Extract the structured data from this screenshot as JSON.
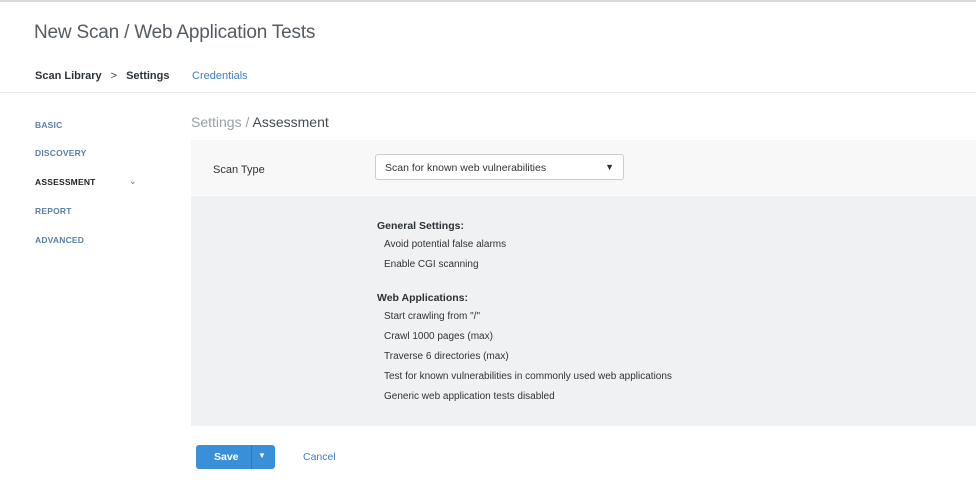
{
  "header": {
    "title": "New Scan / Web Application Tests"
  },
  "nav": {
    "breadcrumb": [
      "Scan Library",
      "Settings"
    ],
    "separator": ">",
    "credentials_link": "Credentials"
  },
  "sidebar": {
    "items": [
      {
        "label": "BASIC",
        "active": false
      },
      {
        "label": "DISCOVERY",
        "active": false
      },
      {
        "label": "ASSESSMENT",
        "active": true,
        "icon": "chevron-down-icon"
      },
      {
        "label": "REPORT",
        "active": false
      },
      {
        "label": "ADVANCED",
        "active": false
      }
    ]
  },
  "section": {
    "parent": "Settings",
    "separator": " / ",
    "current": "Assessment"
  },
  "scan_type": {
    "label": "Scan Type",
    "selected": "Scan for known web vulnerabilities",
    "caret": "▼"
  },
  "general_settings": {
    "heading": "General Settings:",
    "items": [
      "Avoid potential false alarms",
      "Enable CGI scanning"
    ]
  },
  "web_applications": {
    "heading": "Web Applications:",
    "items": [
      "Start crawling from \"/\"",
      "Crawl 1000 pages (max)",
      "Traverse 6 directories (max)",
      "Test for known vulnerabilities in commonly used web applications",
      "Generic web application tests disabled"
    ]
  },
  "footer": {
    "save_label": "Save",
    "save_caret": "▼",
    "cancel_label": "Cancel"
  },
  "colors": {
    "accent": "#3a8fd9",
    "link": "#3d7ec0",
    "sidebar_link": "#5a7fa5",
    "chevron": "#5aa85a",
    "panel_bg": "#eff1f3"
  }
}
